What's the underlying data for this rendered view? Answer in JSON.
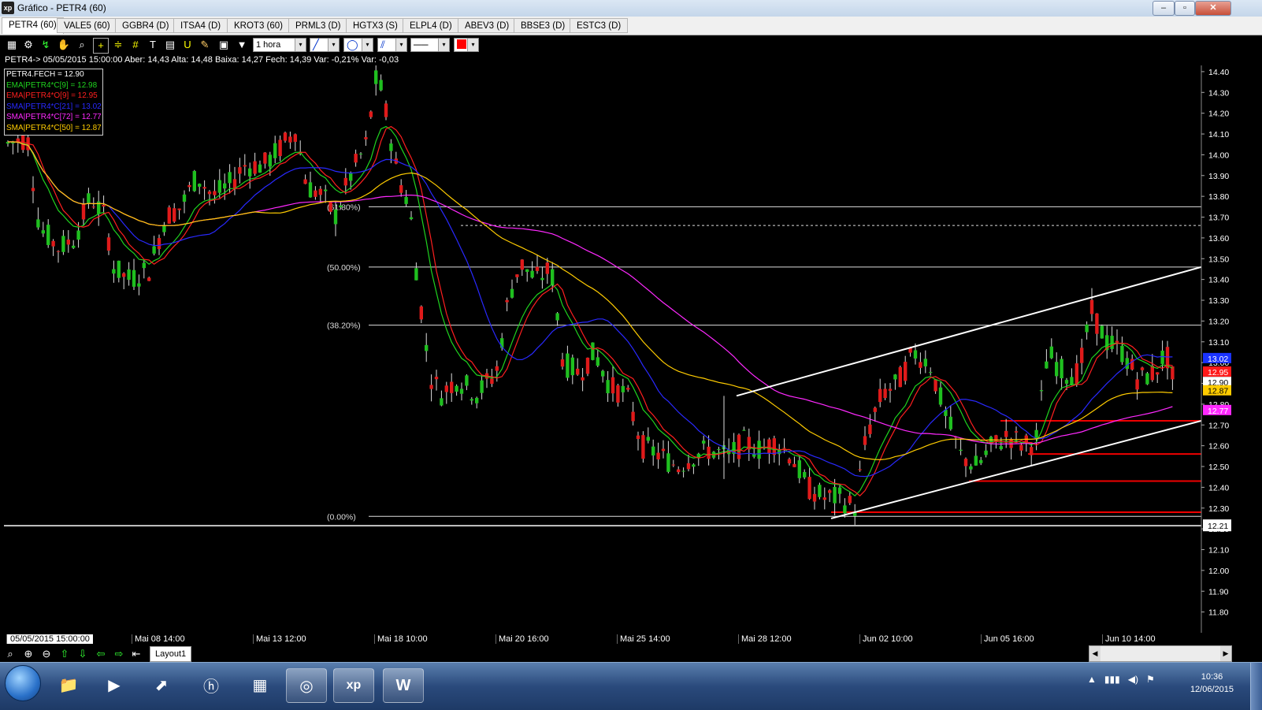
{
  "window": {
    "title": "Gráfico - PETR4 (60)",
    "logo_text": "xp",
    "buttons": [
      "–",
      "▫",
      "✕"
    ]
  },
  "tabs": [
    "PETR4 (60)",
    "VALE5 (60)",
    "GGBR4 (D)",
    "ITSA4 (D)",
    "KROT3 (60)",
    "PRML3 (D)",
    "HGTX3 (S)",
    "ELPL4 (D)",
    "ABEV3 (D)",
    "BBSE3 (D)",
    "ESTC3 (D)"
  ],
  "toolbar": {
    "timeframe": "1 hora",
    "arrow": "▾"
  },
  "info_line": "PETR4-> 05/05/2015 15:00:00 Aber: 14,43 Alta: 14,48 Baixa: 14,27 Fech: 14,39 Var: -0,21% Var: -0,03",
  "legend": [
    {
      "text": "PETR4.FECH = 12.90",
      "color": "#ffffff"
    },
    {
      "text": "EMA|PETR4*C[9] = 12.98",
      "color": "#1fd31f"
    },
    {
      "text": "EMA|PETR4*O[9] = 12.95",
      "color": "#ff1f1f"
    },
    {
      "text": "SMA|PETR4*C[21] = 13.02",
      "color": "#2929ff"
    },
    {
      "text": "SMA|PETR4*C[72] = 12.77",
      "color": "#ff29ff"
    },
    {
      "text": "SMA|PETR4*C[50] = 12.87",
      "color": "#ffcc00"
    }
  ],
  "chart_data": {
    "type": "candlestick",
    "symbol": "PETR4",
    "interval": "1 hora",
    "ylim": [
      11.7,
      14.43
    ],
    "y_ticks": [
      "14.40",
      "14.30",
      "14.20",
      "14.10",
      "14.00",
      "13.90",
      "13.80",
      "13.70",
      "13.60",
      "13.50",
      "13.40",
      "13.30",
      "13.20",
      "13.10",
      "13.00",
      "12.90",
      "12.80",
      "12.70",
      "12.60",
      "12.50",
      "12.40",
      "12.30",
      "12.20",
      "12.10",
      "12.00",
      "11.90",
      "11.80"
    ],
    "x_labels": [
      "05/05/2015 15:00:00",
      "Mai 08 14:00",
      "Mai 13 12:00",
      "Mai 18 10:00",
      "Mai 20 16:00",
      "Mai 25 14:00",
      "Mai 28 12:00",
      "Jun 02 10:00",
      "Jun 05 16:00",
      "Jun 10 14:00"
    ],
    "fib_levels": [
      {
        "label": "(61.80%)",
        "value": 13.75
      },
      {
        "label": "(50.00%)",
        "value": 13.46
      },
      {
        "label": "(38.20%)",
        "value": 13.18
      },
      {
        "label": "(0.00%)",
        "value": 12.26
      }
    ],
    "current_price_line": {
      "label": "12.21",
      "value": 12.215
    },
    "dashed_line_value": 13.66,
    "value_tags": [
      {
        "label": "13.02",
        "value": 13.02,
        "bg": "#1a33ff",
        "fg": "#ffffff"
      },
      {
        "label": "12.95",
        "value": 12.955,
        "bg": "#ff1a1a",
        "fg": "#ffffff"
      },
      {
        "label": "12.90",
        "value": 12.905,
        "bg": "#ffffff",
        "fg": "#000000"
      },
      {
        "label": "12.87",
        "value": 12.865,
        "bg": "#ffcc00",
        "fg": "#000000"
      },
      {
        "label": "12.77",
        "value": 12.77,
        "bg": "#ff29ff",
        "fg": "#ffffff"
      }
    ],
    "support_lines": [
      12.72,
      12.56,
      12.43,
      12.28
    ],
    "channel": {
      "upper": [
        12.84,
        13.46
      ],
      "lower": [
        12.25,
        12.72
      ]
    }
  }
}
